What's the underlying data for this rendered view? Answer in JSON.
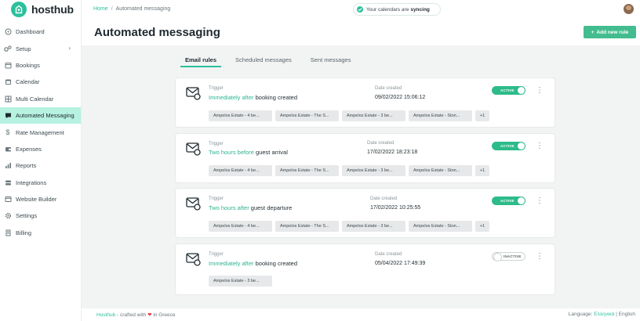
{
  "brand": {
    "name": "hosthub",
    "accent": "#2cc09c"
  },
  "sidebar": {
    "items": [
      {
        "label": "Dashboard",
        "icon": "dashboard-icon"
      },
      {
        "label": "Setup",
        "icon": "gears-icon",
        "has_chevron": true
      },
      {
        "label": "Bookings",
        "icon": "bookings-icon"
      },
      {
        "label": "Calendar",
        "icon": "calendar-icon"
      },
      {
        "label": "Multi Calendar",
        "icon": "multi-calendar-icon"
      },
      {
        "label": "Automated Messaging",
        "icon": "message-icon",
        "active": true
      },
      {
        "label": "Rate Management",
        "icon": "dollar-icon"
      },
      {
        "label": "Expenses",
        "icon": "expenses-icon"
      },
      {
        "label": "Reports",
        "icon": "reports-icon"
      },
      {
        "label": "Integrations",
        "icon": "integrations-icon"
      },
      {
        "label": "Website Builder",
        "icon": "website-icon"
      },
      {
        "label": "Settings",
        "icon": "settings-icon"
      },
      {
        "label": "Billing",
        "icon": "billing-icon"
      }
    ]
  },
  "header": {
    "breadcrumb_home": "Home",
    "breadcrumb_sep": "/",
    "breadcrumb_current": "Automated messaging",
    "sync_prefix": "Your calendars are",
    "sync_status": "syncing"
  },
  "page": {
    "title": "Automated messaging",
    "add_button_label": "Add new rule"
  },
  "tabs": [
    {
      "label": "Email rules",
      "active": true
    },
    {
      "label": "Scheduled messages",
      "active": false
    },
    {
      "label": "Sent messages",
      "active": false
    }
  ],
  "rules": [
    {
      "trigger_label": "Trigger",
      "timing": "Immediately after",
      "event": "booking created",
      "date_label": "Date created",
      "date": "09/02/2022 15:06:12",
      "status": "ACTIVE",
      "properties": [
        "Ampelos Estate - 4 be...",
        "Ampelos Estate - The S...",
        "Ampelos Estate - 3 be...",
        "Ampelos Estate - Ston..."
      ],
      "more": "+1"
    },
    {
      "trigger_label": "Trigger",
      "timing": "Two hours before",
      "event": "guest arrival",
      "date_label": "Date created",
      "date": "17/02/2022 18:23:18",
      "status": "ACTIVE",
      "properties": [
        "Ampelos Estate - 4 be...",
        "Ampelos Estate - The S...",
        "Ampelos Estate - 3 be...",
        "Ampelos Estate - Ston..."
      ],
      "more": "+1"
    },
    {
      "trigger_label": "Trigger",
      "timing": "Two hours after",
      "event": "guest departure",
      "date_label": "Date created",
      "date": "17/02/2022 10:25:55",
      "status": "ACTIVE",
      "properties": [
        "Ampelos Estate - 4 be...",
        "Ampelos Estate - The S...",
        "Ampelos Estate - 3 be...",
        "Ampelos Estate - Ston..."
      ],
      "more": "+1"
    },
    {
      "trigger_label": "Trigger",
      "timing": "Immediately after",
      "event": "booking created",
      "date_label": "Date created",
      "date": "05/04/2022 17:49:39",
      "status": "INACTIVE",
      "properties": [
        "Ampelos Estate - 3 be..."
      ],
      "more": ""
    }
  ],
  "footer": {
    "brand": "Hosthub",
    "crafted": "- crafted with",
    "heart": "❤",
    "location": "in Greece",
    "language_label": "Language:",
    "lang_current": "Ελληνικά",
    "lang_sep": "|",
    "lang_other": "English"
  }
}
